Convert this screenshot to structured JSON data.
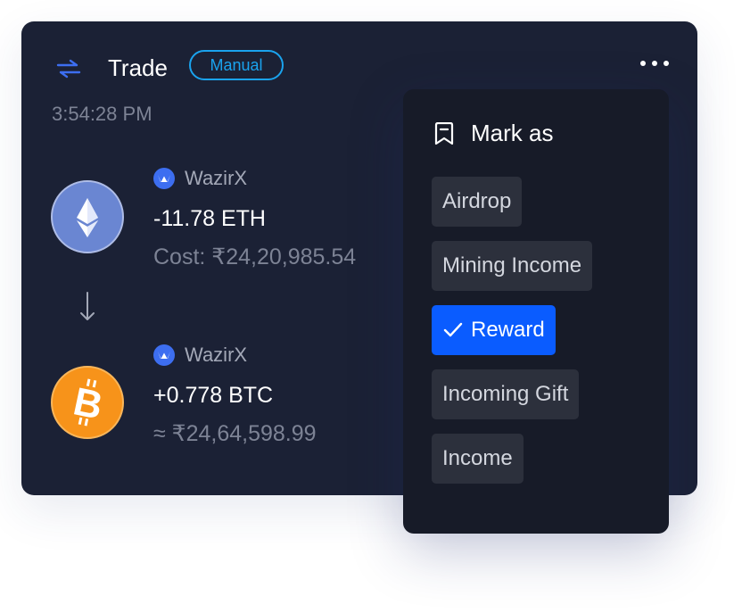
{
  "card": {
    "title": "Trade",
    "mode_badge": "Manual",
    "time": "3:54:28 PM",
    "sent": {
      "coin_icon": "ethereum-icon",
      "exchange": "WazirX",
      "amount": "-11.78 ETH",
      "cost": "Cost: ₹24,20,985.54"
    },
    "received": {
      "coin_icon": "bitcoin-icon",
      "exchange": "WazirX",
      "amount": "+0.778 BTC",
      "value": "≈ ₹24,64,598.99"
    }
  },
  "menu": {
    "title": "Mark as",
    "options": [
      {
        "label": "Airdrop",
        "selected": false
      },
      {
        "label": "Mining Income",
        "selected": false
      },
      {
        "label": "Reward",
        "selected": true
      },
      {
        "label": "Incoming Gift",
        "selected": false
      },
      {
        "label": "Income",
        "selected": false
      }
    ]
  },
  "colors": {
    "card_bg": "#1b2135",
    "menu_bg": "#171b28",
    "accent": "#1aa3ee",
    "selected": "#0a5cff",
    "eth": "#6a86d2",
    "btc": "#f7931a"
  }
}
